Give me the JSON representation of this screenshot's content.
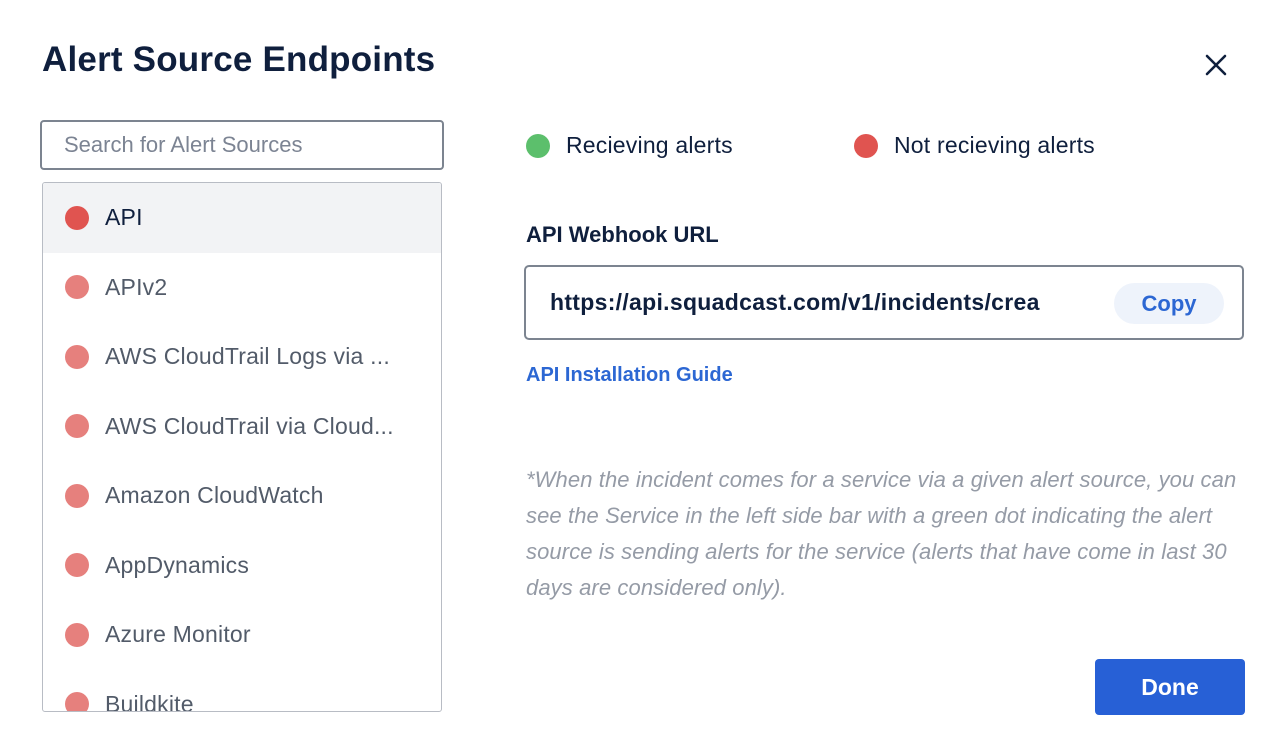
{
  "modal": {
    "title": "Alert Source Endpoints",
    "close_icon": "close-icon"
  },
  "search": {
    "placeholder": "Search for Alert Sources",
    "value": ""
  },
  "alert_sources": [
    {
      "label": "API",
      "status": "not-receiving",
      "selected": true
    },
    {
      "label": "APIv2",
      "status": "not-receiving",
      "selected": false
    },
    {
      "label": "AWS CloudTrail Logs via ...",
      "status": "not-receiving",
      "selected": false
    },
    {
      "label": "AWS CloudTrail via Cloud...",
      "status": "not-receiving",
      "selected": false
    },
    {
      "label": "Amazon CloudWatch",
      "status": "not-receiving",
      "selected": false
    },
    {
      "label": "AppDynamics",
      "status": "not-receiving",
      "selected": false
    },
    {
      "label": "Azure Monitor",
      "status": "not-receiving",
      "selected": false
    },
    {
      "label": "Buildkite",
      "status": "not-receiving",
      "selected": false
    }
  ],
  "legend": {
    "receiving": "Recieving alerts",
    "not_receiving": "Not recieving alerts"
  },
  "webhook": {
    "label": "API Webhook URL",
    "url": "https://api.squadcast.com/v1/incidents/crea",
    "copy_label": "Copy"
  },
  "guide_link": "API Installation Guide",
  "note": "*When the incident comes for a service via a given alert source, you can see the Service in the left side bar with a green dot indicating the alert source is sending alerts for the service (alerts that have come in last 30 days are considered only).",
  "done_label": "Done",
  "colors": {
    "receiving": "#5cbf6c",
    "not_receiving": "#e05450",
    "not_receiving_muted": "#e6807d",
    "accent": "#2760d6",
    "link": "#2c67d3"
  }
}
